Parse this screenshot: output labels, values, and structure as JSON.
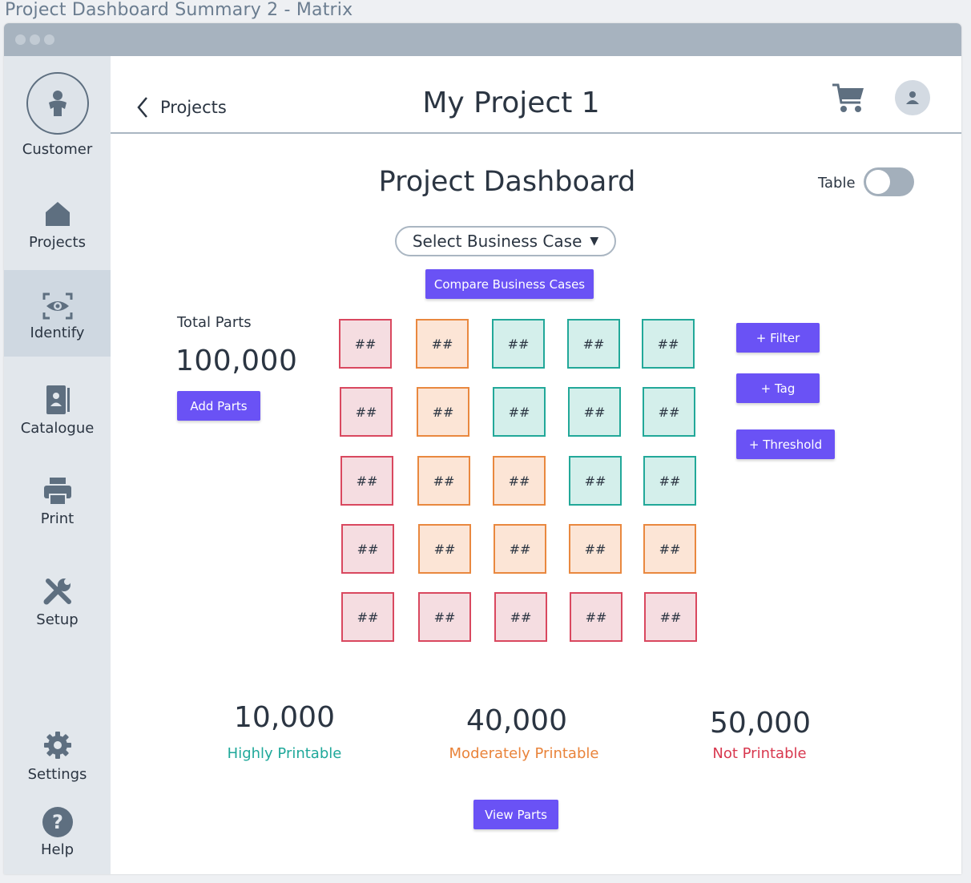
{
  "page_title": "Project Dashboard Summary 2 - Matrix",
  "sidebar": {
    "items": [
      {
        "label": "Customer",
        "icon": "person-icon"
      },
      {
        "label": "Projects",
        "icon": "home-icon"
      },
      {
        "label": "Identify",
        "icon": "eye-scan-icon",
        "active": true
      },
      {
        "label": "Catalogue",
        "icon": "catalogue-icon"
      },
      {
        "label": "Print",
        "icon": "printer-icon"
      },
      {
        "label": "Setup",
        "icon": "tools-icon"
      },
      {
        "label": "Settings",
        "icon": "gear-icon"
      },
      {
        "label": "Help",
        "icon": "help-icon"
      }
    ]
  },
  "header": {
    "back_label": "Projects",
    "project_title": "My Project 1"
  },
  "dashboard": {
    "title": "Project Dashboard",
    "table_toggle_label": "Table",
    "table_toggle_on": false,
    "business_case_placeholder": "Select Business Case",
    "compare_button": "Compare Business Cases",
    "total_parts_label": "Total Parts",
    "total_parts_value": "100,000",
    "add_parts_button": "Add Parts",
    "filter_button": "+ Filter",
    "tag_button": "+ Tag",
    "threshold_button": "+ Threshold",
    "cell_text": "##",
    "matrix": [
      [
        "red",
        "orange",
        "teal",
        "teal",
        "teal"
      ],
      [
        "red",
        "orange",
        "teal",
        "teal",
        "teal"
      ],
      [
        "red",
        "orange",
        "orange",
        "teal",
        "teal"
      ],
      [
        "red",
        "orange",
        "orange",
        "orange",
        "orange"
      ],
      [
        "red",
        "red",
        "red",
        "red",
        "red"
      ]
    ],
    "stats": [
      {
        "value": "10,000",
        "label": "Highly Printable",
        "color": "#1fa89a"
      },
      {
        "value": "40,000",
        "label": "Moderately Printable",
        "color": "#e9833a"
      },
      {
        "value": "50,000",
        "label": "Not Printable",
        "color": "#d8384f"
      }
    ],
    "view_parts_button": "View Parts"
  },
  "colors": {
    "accent": "#6a52f5",
    "red": "#d9485f",
    "orange": "#e9883f",
    "teal": "#22a899"
  }
}
